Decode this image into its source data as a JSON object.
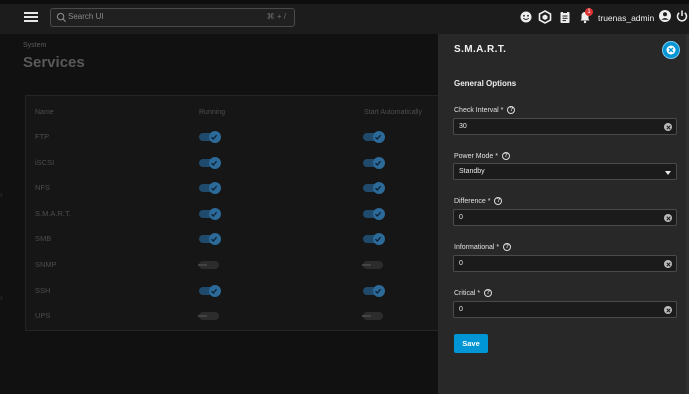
{
  "topbar": {
    "search_placeholder": "Search UI",
    "search_shortcut": "⌘ + /",
    "notification_count": "1",
    "username": "truenas_admin"
  },
  "page": {
    "breadcrumb": "System",
    "title": "Services",
    "columns": [
      "Name",
      "Running",
      "Start Automatically"
    ],
    "services": [
      {
        "name": "FTP",
        "running": true,
        "start_automatically": true
      },
      {
        "name": "iSCSI",
        "running": true,
        "start_automatically": true
      },
      {
        "name": "NFS",
        "running": true,
        "start_automatically": true
      },
      {
        "name": "S.M.A.R.T.",
        "running": true,
        "start_automatically": true
      },
      {
        "name": "SMB",
        "running": true,
        "start_automatically": true
      },
      {
        "name": "SNMP",
        "running": false,
        "start_automatically": false
      },
      {
        "name": "SSH",
        "running": true,
        "start_automatically": true
      },
      {
        "name": "UPS",
        "running": false,
        "start_automatically": false
      }
    ]
  },
  "panel": {
    "title": "S.M.A.R.T.",
    "section": "General Options",
    "fields": [
      {
        "label": "Check Interval *",
        "value": "30",
        "type": "text"
      },
      {
        "label": "Power Mode *",
        "value": "Standby",
        "type": "select"
      },
      {
        "label": "Difference *",
        "value": "0",
        "type": "text"
      },
      {
        "label": "Informational *",
        "value": "0",
        "type": "text"
      },
      {
        "label": "Critical *",
        "value": "0",
        "type": "text"
      }
    ],
    "save_label": "Save"
  },
  "colors": {
    "accent": "#0095d5",
    "toggle_on": "#2b6a99",
    "badge": "#dd3333"
  },
  "icons": [
    "menu-icon",
    "search-icon",
    "feedback-icon",
    "truecommand-icon",
    "tasks-icon",
    "bell-icon",
    "account-icon",
    "power-icon",
    "close-icon",
    "help-icon",
    "clear-icon",
    "dropdown-caret-icon"
  ]
}
